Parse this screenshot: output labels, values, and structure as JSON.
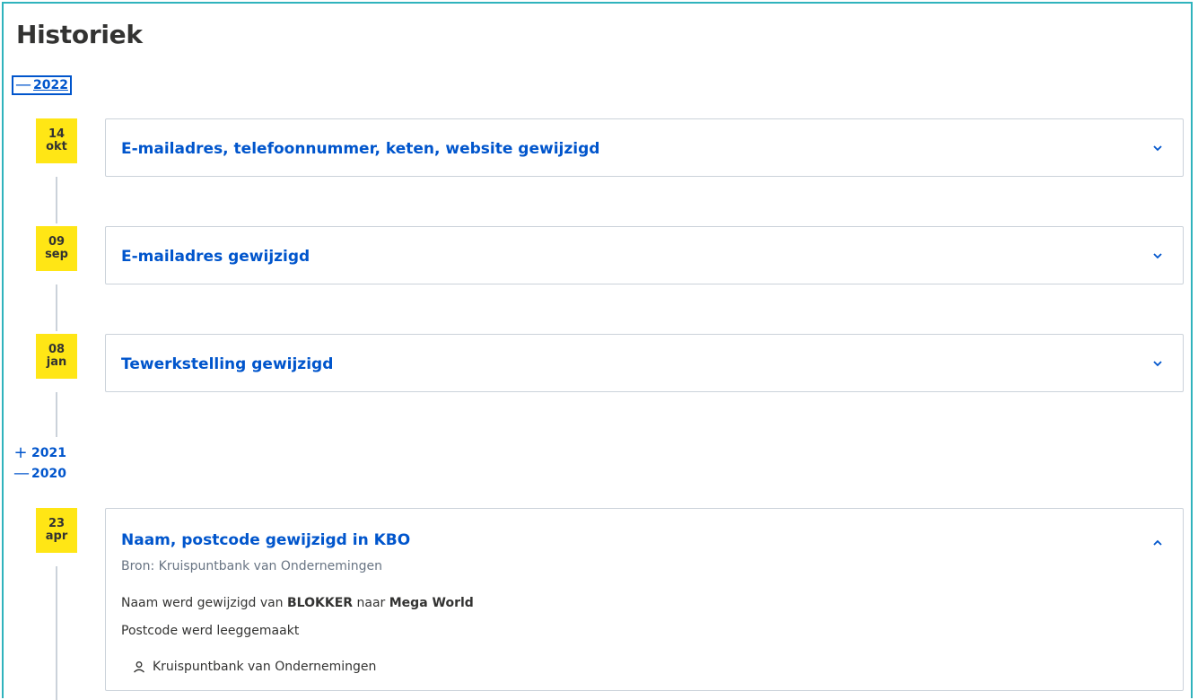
{
  "page": {
    "title": "Historiek"
  },
  "years": [
    {
      "year": "2022",
      "symbol": "—",
      "expanded": true
    },
    {
      "year": "2021",
      "symbol": "+",
      "expanded": false
    },
    {
      "year": "2020",
      "symbol": "—",
      "expanded": true
    }
  ],
  "entries": [
    {
      "day": "14",
      "month": "okt",
      "title": "E-mailadres, telefoonnummer, keten, website gewijzigd",
      "expanded": false
    },
    {
      "day": "09",
      "month": "sep",
      "title": "E-mailadres gewijzigd",
      "expanded": false
    },
    {
      "day": "08",
      "month": "jan",
      "title": "Tewerkstelling gewijzigd",
      "expanded": false
    },
    {
      "day": "23",
      "month": "apr",
      "title": "Naam, postcode gewijzigd in KBO",
      "expanded": true,
      "subtitle": "Bron: Kruispuntbank van Ondernemingen",
      "line1": {
        "prefix": "Naam werd gewijzigd van ",
        "old": "BLOKKER",
        "middle": " naar ",
        "new": "Mega World"
      },
      "line2": "Postcode werd leeggemaakt",
      "source": "Kruispuntbank van Ondernemingen"
    }
  ],
  "icons": {
    "expand": "chevron-down-icon",
    "collapse": "chevron-up-icon",
    "source": "person-icon"
  },
  "colors": {
    "accent": "#0055cc",
    "date_badge": "#ffe615",
    "frame": "#2fb3bd"
  }
}
